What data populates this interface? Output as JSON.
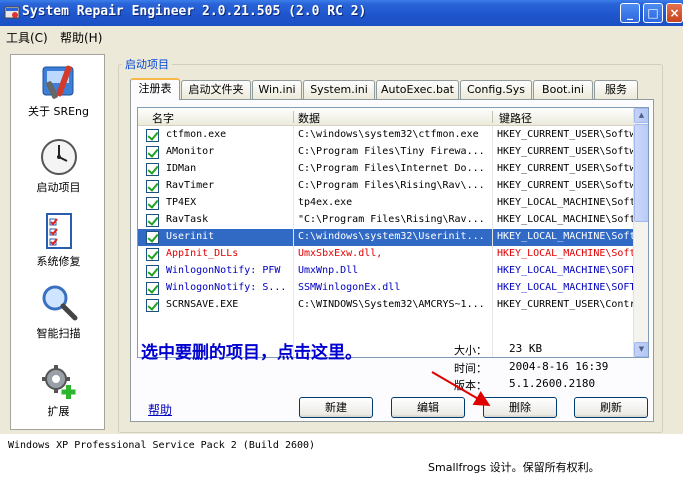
{
  "window": {
    "title": "System Repair Engineer 2.0.21.505 (2.0 RC 2)",
    "buttons": [
      "_",
      "□",
      "×"
    ]
  },
  "menu": [
    "工具(C)",
    "帮助(H)"
  ],
  "sidebar": {
    "items": [
      {
        "label": "关于 SREng",
        "icon": "tools-icon"
      },
      {
        "label": "启动项目",
        "icon": "clock-icon"
      },
      {
        "label": "系统修复",
        "icon": "checklist-icon"
      },
      {
        "label": "智能扫描",
        "icon": "magnifier-icon"
      },
      {
        "label": "扩展",
        "icon": "gear-plus-icon"
      }
    ]
  },
  "group_title": "启动项目",
  "tabs": [
    "注册表",
    "启动文件夹",
    "Win.ini",
    "System.ini",
    "AutoExec.bat",
    "Config.Sys",
    "Boot.ini",
    "服务"
  ],
  "active_tab": "注册表",
  "list": {
    "columns": [
      "名字",
      "数据",
      "键路径"
    ],
    "rows": [
      {
        "name": "ctfmon.exe",
        "data": "C:\\windows\\system32\\ctfmon.exe",
        "key": "HKEY_CURRENT_USER\\Software",
        "style": "normal"
      },
      {
        "name": "AMonitor",
        "data": "C:\\Program Files\\Tiny Firewa...",
        "key": "HKEY_CURRENT_USER\\Software",
        "style": "normal"
      },
      {
        "name": "IDMan",
        "data": "C:\\Program Files\\Internet Do...",
        "key": "HKEY_CURRENT_USER\\Software",
        "style": "normal"
      },
      {
        "name": "RavTimer",
        "data": "C:\\Program Files\\Rising\\Rav\\...",
        "key": "HKEY_CURRENT_USER\\Software",
        "style": "normal"
      },
      {
        "name": "TP4EX",
        "data": "tp4ex.exe",
        "key": "HKEY_LOCAL_MACHINE\\Software",
        "style": "normal"
      },
      {
        "name": "RavTask",
        "data": "\"C:\\Program Files\\Rising\\Rav...",
        "key": "HKEY_LOCAL_MACHINE\\Software",
        "style": "normal"
      },
      {
        "name": "Userinit",
        "data": "C:\\windows\\system32\\Userinit...",
        "key": "HKEY_LOCAL_MACHINE\\Software",
        "style": "selected"
      },
      {
        "name": "AppInit_DLLs",
        "data": "UmxSbxExw.dll,",
        "key": "HKEY_LOCAL_MACHINE\\Software",
        "style": "red"
      },
      {
        "name": "WinlogonNotify: PFW",
        "data": "UmxWnp.Dll",
        "key": "HKEY_LOCAL_MACHINE\\SOFTWARE",
        "style": "blue"
      },
      {
        "name": "WinlogonNotify: S...",
        "data": "SSMWinlogonEx.dll",
        "key": "HKEY_LOCAL_MACHINE\\SOFTWARE",
        "style": "blue"
      },
      {
        "name": "SCRNSAVE.EXE",
        "data": "C:\\WINDOWS\\System32\\AMCRYS~1...",
        "key": "HKEY_CURRENT_USER\\Control",
        "style": "normal"
      }
    ]
  },
  "hint": "选中要删的项目，点击这里。",
  "info": {
    "size_label": "大小：",
    "size_value": "23 KB",
    "time_label": "时间：",
    "time_value": "2004-8-16 16:39",
    "version_label": "版本：",
    "version_value": "5.1.2600.2180"
  },
  "help_link": "帮助",
  "buttons": {
    "new": "新建",
    "edit": "编辑",
    "delete": "删除",
    "refresh": "刷新"
  },
  "status": {
    "os": "Windows XP Professional Service Pack 2 (Build 2600)",
    "copyright": "Smallfrogs 设计。保留所有权利。"
  },
  "colors": {
    "title_bar": "#1e54cc",
    "selection": "#316ac5",
    "hint": "#0000d0",
    "red_row": "#e00000",
    "blue_row": "#0000c0",
    "arrow": "#e00000"
  }
}
